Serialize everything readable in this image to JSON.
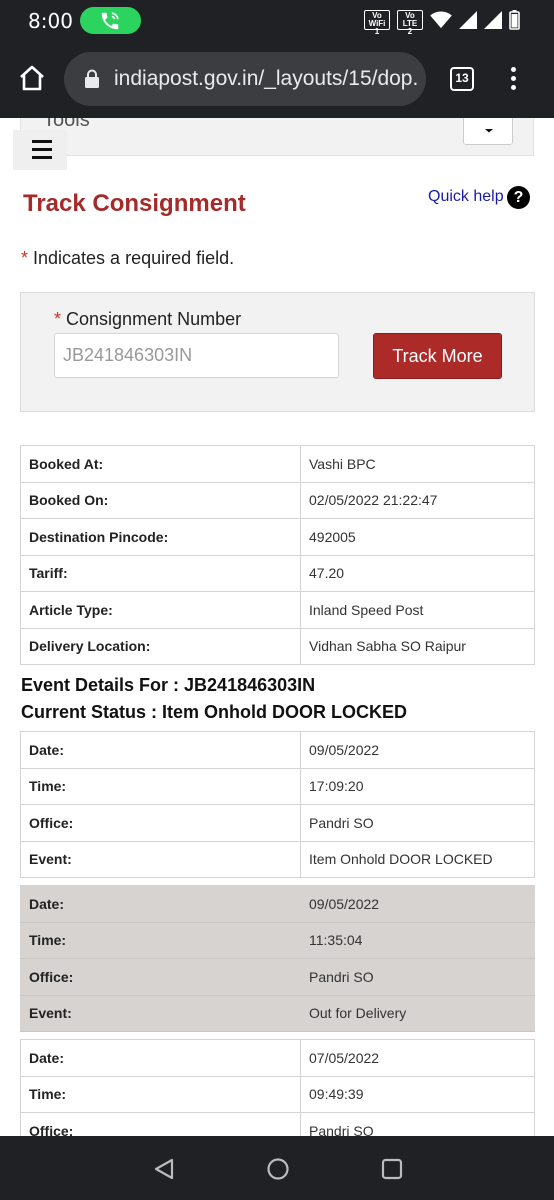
{
  "status_bar": {
    "time": "8:00",
    "vowifi_label": "Vo WiFi 1",
    "volte_label": "Vo LTE 2",
    "icons": [
      "call-active-icon",
      "wifi-icon",
      "signal-icon",
      "signal-icon",
      "battery-icon"
    ]
  },
  "browser": {
    "url": "indiapost.gov.in/_layouts/15/dop.",
    "tab_count": "13"
  },
  "header": {
    "tools_label": "Tools",
    "menu_icon": "hamburger-icon"
  },
  "page": {
    "title": "Track Consignment",
    "quick_help": "Quick help",
    "help_symbol": "?",
    "required_star": "*",
    "required_note": " Indicates a required field."
  },
  "form": {
    "label_star": "*",
    "label": "Consignment Number",
    "value": "JB241846303IN",
    "button": "Track More"
  },
  "booking": [
    {
      "key": "Booked At:",
      "value": "Vashi BPC"
    },
    {
      "key": "Booked On:",
      "value": "02/05/2022 21:22:47"
    },
    {
      "key": "Destination Pincode:",
      "value": "492005"
    },
    {
      "key": "Tariff:",
      "value": "47.20"
    },
    {
      "key": "Article Type:",
      "value": "Inland Speed Post"
    },
    {
      "key": "Delivery Location:",
      "value": "Vidhan Sabha SO Raipur"
    }
  ],
  "event_details_title": "Event Details For : JB241846303IN",
  "current_status": "Current Status : Item Onhold DOOR LOCKED",
  "events": [
    [
      {
        "key": "Date:",
        "value": "09/05/2022"
      },
      {
        "key": "Time:",
        "value": "17:09:20"
      },
      {
        "key": "Office:",
        "value": "Pandri SO"
      },
      {
        "key": "Event:",
        "value": "Item Onhold DOOR LOCKED"
      }
    ],
    [
      {
        "key": "Date:",
        "value": "09/05/2022"
      },
      {
        "key": "Time:",
        "value": "11:35:04"
      },
      {
        "key": "Office:",
        "value": "Pandri SO"
      },
      {
        "key": "Event:",
        "value": "Out for Delivery"
      }
    ],
    [
      {
        "key": "Date:",
        "value": "07/05/2022"
      },
      {
        "key": "Time:",
        "value": "09:49:39"
      },
      {
        "key": "Office:",
        "value": "Pandri SO"
      }
    ]
  ],
  "nav": {
    "icons": [
      "back-icon",
      "home-circle-icon",
      "recents-icon"
    ]
  }
}
